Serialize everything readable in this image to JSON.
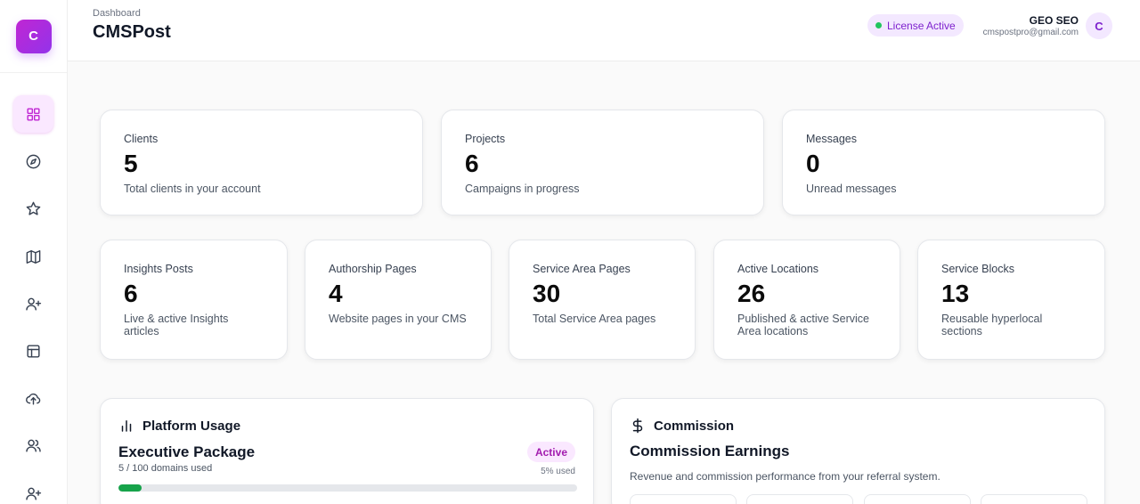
{
  "brand": {
    "logo_letter": "C",
    "accent": "#a855f7"
  },
  "header": {
    "breadcrumb": "Dashboard",
    "title": "CMSPost",
    "license_label": "License Active",
    "license_color": "#22c55e",
    "user_name": "GEO SEO",
    "user_email": "cmspostpro@gmail.com",
    "avatar_letter": "C"
  },
  "sidebar": {
    "items": [
      {
        "name": "dashboard",
        "icon": "grid-icon",
        "active": true
      },
      {
        "name": "explore",
        "icon": "compass-icon",
        "active": false
      },
      {
        "name": "favorites",
        "icon": "star-icon",
        "active": false
      },
      {
        "name": "map",
        "icon": "map-icon",
        "active": false
      },
      {
        "name": "add-user",
        "icon": "user-plus-icon",
        "active": false
      },
      {
        "name": "layout",
        "icon": "layout-icon",
        "active": false
      },
      {
        "name": "upload",
        "icon": "cloud-upload-icon",
        "active": false
      },
      {
        "name": "users",
        "icon": "users-icon",
        "active": false
      },
      {
        "name": "invite",
        "icon": "user-plus-icon",
        "active": false
      }
    ]
  },
  "stats_top": [
    {
      "label": "Clients",
      "value": "5",
      "desc": "Total clients in your account"
    },
    {
      "label": "Projects",
      "value": "6",
      "desc": "Campaigns in progress"
    },
    {
      "label": "Messages",
      "value": "0",
      "desc": "Unread messages"
    }
  ],
  "stats_bottom": [
    {
      "label": "Insights Posts",
      "value": "6",
      "desc": "Live & active Insights articles"
    },
    {
      "label": "Authorship Pages",
      "value": "4",
      "desc": "Website pages in your CMS"
    },
    {
      "label": "Service Area Pages",
      "value": "30",
      "desc": "Total Service Area pages"
    },
    {
      "label": "Active Locations",
      "value": "26",
      "desc": "Published & active Service Area locations"
    },
    {
      "label": "Service Blocks",
      "value": "13",
      "desc": "Reusable hyperlocal sections"
    }
  ],
  "usage": {
    "heading": "Platform Usage",
    "package": "Executive Package",
    "domains": "5 / 100 domains used",
    "status": "Active",
    "used_pct_label": "5% used",
    "used_fraction": 0.05,
    "bar_color": "#16a34a"
  },
  "commission": {
    "heading": "Commission",
    "title": "Commission Earnings",
    "desc": "Revenue and commission performance from your referral system."
  }
}
